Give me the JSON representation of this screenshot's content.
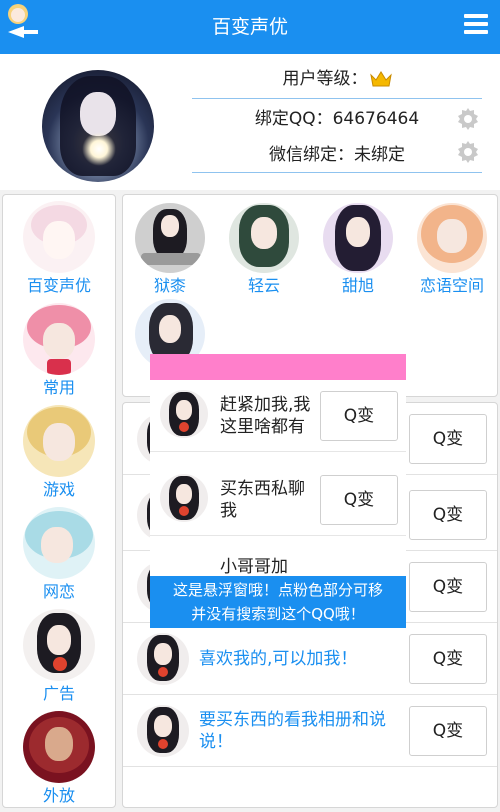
{
  "header": {
    "title": "百变声优"
  },
  "profile": {
    "level_label": "用户等级：",
    "qq_label": "绑定QQ：",
    "qq_value": "64676464",
    "wechat_label": "微信绑定：",
    "wechat_value": "未绑定"
  },
  "sidebar": {
    "items": [
      {
        "label": "百变声优"
      },
      {
        "label": "常用"
      },
      {
        "label": "游戏"
      },
      {
        "label": "网恋"
      },
      {
        "label": "广告"
      },
      {
        "label": "外放"
      }
    ]
  },
  "friends": [
    {
      "label": "狱桼"
    },
    {
      "label": "轻云"
    },
    {
      "label": "甜旭"
    },
    {
      "label": "恋语空间"
    }
  ],
  "list": {
    "button_label": "Q变",
    "rows": [
      {
        "text": ""
      },
      {
        "text": ""
      },
      {
        "text": ""
      },
      {
        "text": "喜欢我的,可以加我！"
      },
      {
        "text": "要买东西的看我相册和说说！"
      }
    ]
  },
  "floating": {
    "rows": [
      {
        "text": "赶紧加我,我这里啥都有"
      },
      {
        "text": "买东西私聊我"
      }
    ],
    "peek_text": "小哥哥加",
    "notice_line1": "这是悬浮窗哦！点粉色部分可移",
    "notice_line2": "并没有搜索到这个QQ哦！"
  },
  "colors": {
    "primary": "#1a8ff0",
    "float_handle": "#ff7fcb"
  },
  "icons": {
    "back": "back-icon",
    "menu": "menu-icon",
    "crown": "crown-icon",
    "settings": "gear-icon"
  }
}
